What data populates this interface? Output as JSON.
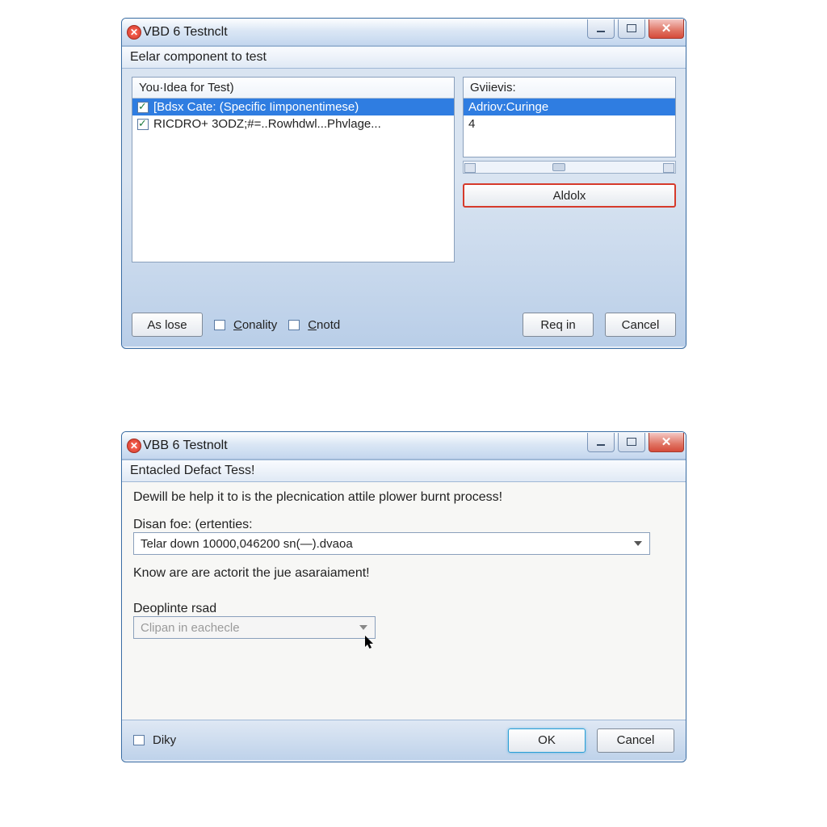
{
  "dialog1": {
    "title": "VBD 6 Testnclt",
    "section_header": "Eelar component to test",
    "left_list": {
      "header": "You·Idea for Test)",
      "items": [
        {
          "checked": true,
          "label": "[Bdsx Cate: (Specific Iimponentimese)",
          "selected": true
        },
        {
          "checked": true,
          "label": "RICDRO+ 3ODZ;#=..Rowhdwl...Phvlage...",
          "selected": false
        }
      ]
    },
    "right_list": {
      "header": "Gviievis:",
      "items": [
        {
          "label": "Adriov:Curinge",
          "selected": true
        },
        {
          "label": "4",
          "selected": false
        }
      ]
    },
    "aldox_button": "Aldolx",
    "footer": {
      "aslose": "As lose",
      "conality": "Conality",
      "cnotd": "Cnotd",
      "reqin": "Req in",
      "cancel": "Cancel"
    }
  },
  "dialog2": {
    "title": "VBB 6 Testnolt",
    "section_header": "Entacled Defact Tess!",
    "description": "Dewill be help it to is the plecnication attile plower burnt process!",
    "field1_label": "Disan foe: (ertenties:",
    "field1_value": "Telar down 10000,046200 sn(—).dvaoa",
    "note": "Know are are actorit the jue asaraiament!",
    "field2_label": "Deoplinte rsad",
    "field2_placeholder": "Clipan in eachecle",
    "footer": {
      "diky": "Diky",
      "ok": "OK",
      "cancel": "Cancel"
    }
  }
}
